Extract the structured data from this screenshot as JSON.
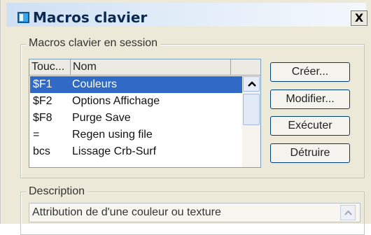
{
  "window": {
    "title": "Macros clavier",
    "close_label": "X"
  },
  "session_group": {
    "label": "Macros clavier en session",
    "columns": [
      "Touc...",
      "Nom"
    ],
    "rows": [
      {
        "key": "$F1",
        "name": "Couleurs",
        "selected": true
      },
      {
        "key": "$F2",
        "name": "Options Affichage",
        "selected": false
      },
      {
        "key": "$F8",
        "name": "Purge Save",
        "selected": false
      },
      {
        "key": "=",
        "name": "Regen using file",
        "selected": false
      },
      {
        "key": "bcs",
        "name": "Lissage Crb-Surf",
        "selected": false
      }
    ]
  },
  "buttons": {
    "create": "Créer...",
    "modify": "Modifier...",
    "execute": "Exécuter",
    "destroy": "Détruire"
  },
  "description": {
    "label": "Description",
    "text": "Attribution de d'une couleur ou texture"
  },
  "colors": {
    "selection": "#316ac5",
    "title_text": "#0b2a52",
    "dialog_bg": "#ece9d8"
  }
}
